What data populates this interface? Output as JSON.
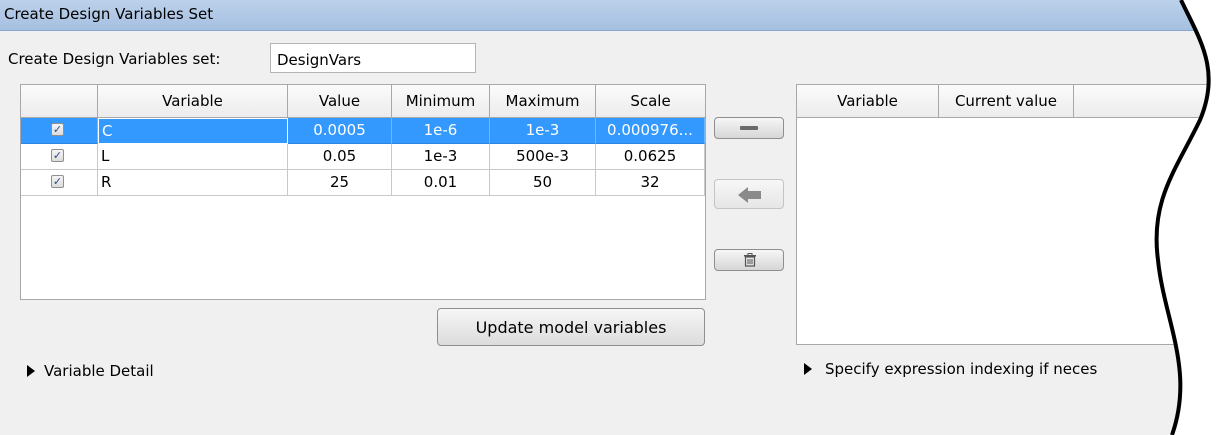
{
  "dialog": {
    "title": "Create Design Variables Set",
    "set_label": "Create Design Variables set:",
    "set_name": "DesignVars"
  },
  "variables_table": {
    "columns": [
      "",
      "Variable",
      "Value",
      "Minimum",
      "Maximum",
      "Scale"
    ],
    "rows": [
      {
        "checked": true,
        "variable": "C",
        "value": "0.0005",
        "minimum": "1e-6",
        "maximum": "1e-3",
        "scale": "0.000976...",
        "selected": true
      },
      {
        "checked": true,
        "variable": "L",
        "value": "0.05",
        "minimum": "1e-3",
        "maximum": "500e-3",
        "scale": "0.0625",
        "selected": false
      },
      {
        "checked": true,
        "variable": "R",
        "value": "25",
        "minimum": "0.01",
        "maximum": "50",
        "scale": "32",
        "selected": false
      }
    ]
  },
  "buttons": {
    "update_model": "Update model variables",
    "remove_icon": "minus-icon",
    "move_icon": "left-arrow-icon",
    "delete_icon": "trash-icon"
  },
  "variable_detail": {
    "label": "Variable Detail"
  },
  "model_table": {
    "columns": [
      "Variable",
      "Current value"
    ]
  },
  "indexing": {
    "label": "Specify expression indexing if neces"
  },
  "colors": {
    "selection": "#3399ff",
    "title_bar": "#a6c0e1"
  }
}
